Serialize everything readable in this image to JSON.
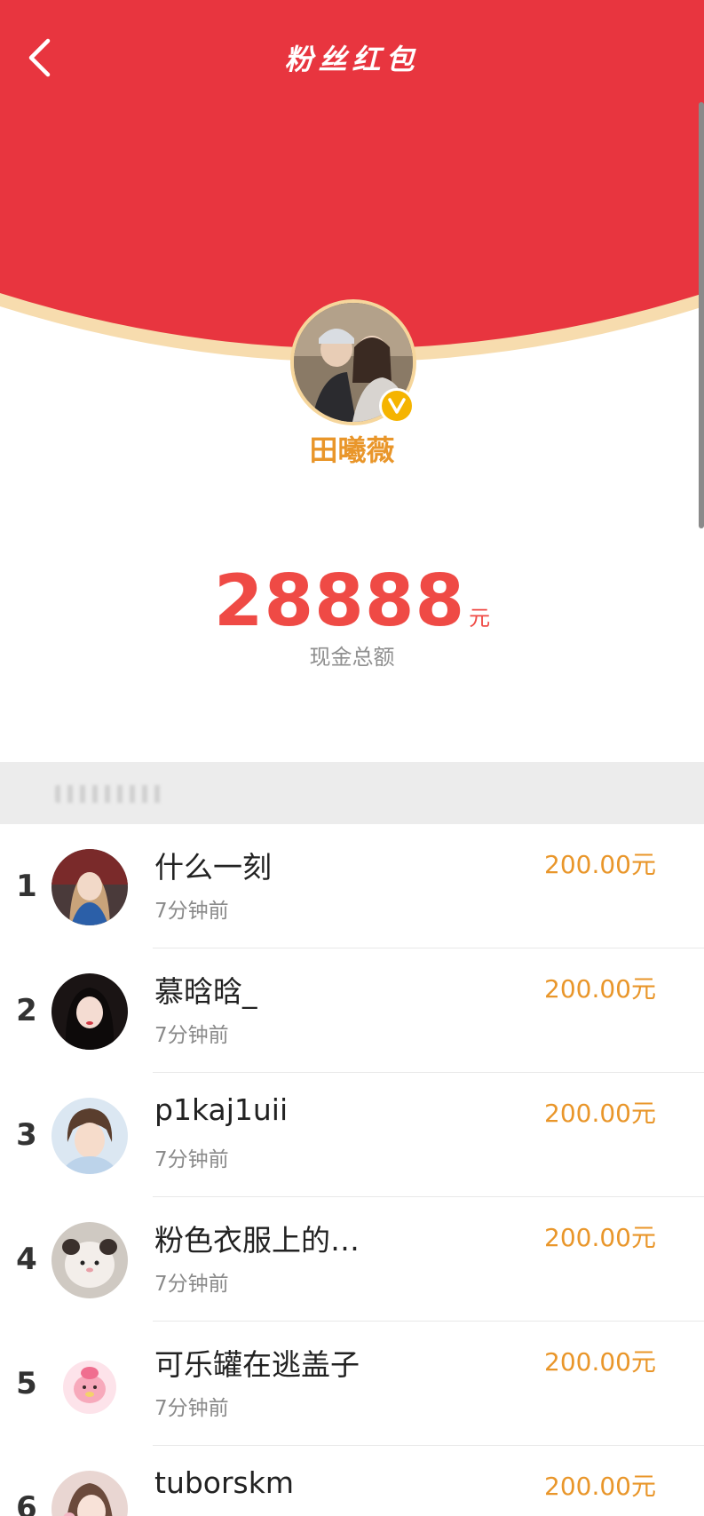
{
  "header": {
    "title": "粉丝红包",
    "back_icon": "chevron-left-icon"
  },
  "host": {
    "name": "田曦薇",
    "verified_badge_text": "V"
  },
  "total": {
    "amount": "28888",
    "unit": "元",
    "label": "现金总额"
  },
  "colors": {
    "red": "#e8353f",
    "gold": "#e9962a",
    "amount_red": "#ef4a45"
  },
  "list": [
    {
      "rank": "1",
      "name": "什么一刻",
      "time": "7分钟前",
      "amount": "200.00元"
    },
    {
      "rank": "2",
      "name": "慕晗晗_",
      "time": "7分钟前",
      "amount": "200.00元"
    },
    {
      "rank": "3",
      "name": "p1kaj1uii",
      "time": "7分钟前",
      "amount": "200.00元"
    },
    {
      "rank": "4",
      "name": "粉色衣服上的…",
      "time": "7分钟前",
      "amount": "200.00元"
    },
    {
      "rank": "5",
      "name": "可乐罐在逃盖子",
      "time": "7分钟前",
      "amount": "200.00元"
    },
    {
      "rank": "6",
      "name": "tuborskm",
      "time": "",
      "amount": "200.00元"
    }
  ]
}
